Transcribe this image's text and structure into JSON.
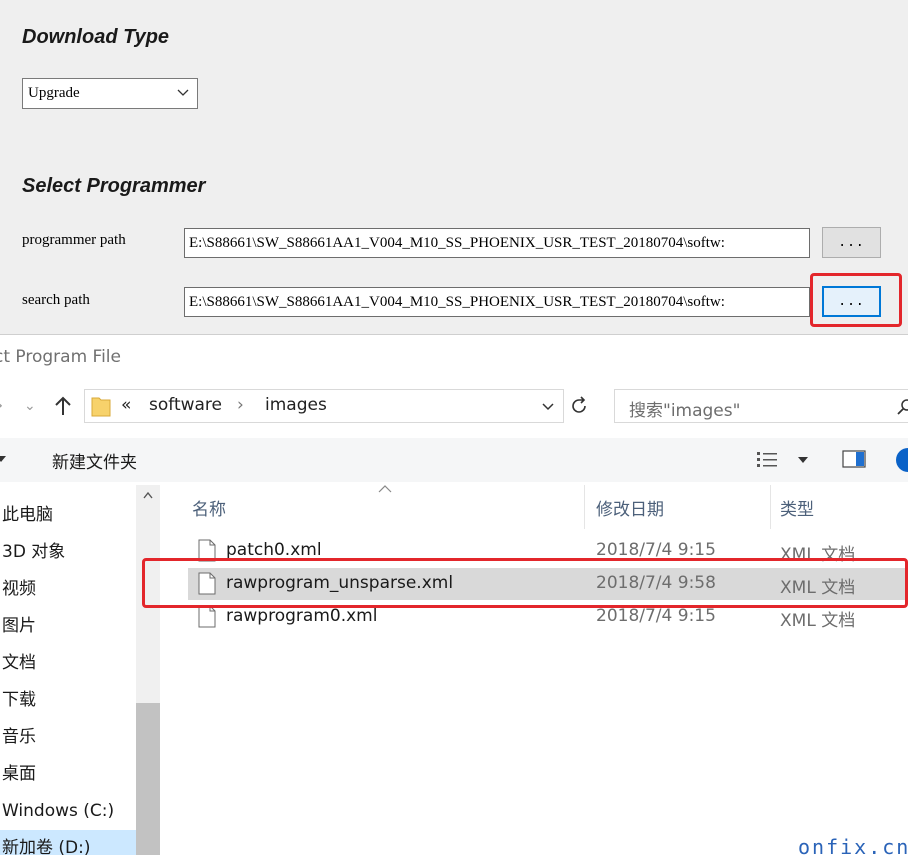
{
  "tool": {
    "download_type_heading": "Download Type",
    "download_type_value": "Upgrade",
    "select_programmer_heading": "Select Programmer",
    "programmer_path_label": "programmer path",
    "programmer_path_value": "E:\\S88661\\SW_S88661AA1_V004_M10_SS_PHOENIX_USR_TEST_20180704\\softw:",
    "search_path_label": "search path",
    "search_path_value": "E:\\S88661\\SW_S88661AA1_V004_M10_SS_PHOENIX_USR_TEST_20180704\\softw:",
    "browse_label": "..."
  },
  "dialog": {
    "title": "ct Program File",
    "breadcrumb": {
      "overflow": "«",
      "parent": "software",
      "sep": "›",
      "current": "images"
    },
    "search_placeholder": "搜索\"images\"",
    "new_folder": "新建文件夹",
    "nav_items": [
      {
        "label": "此电脑",
        "selected": false
      },
      {
        "label": "3D 对象",
        "selected": false
      },
      {
        "label": "视频",
        "selected": false
      },
      {
        "label": "图片",
        "selected": false
      },
      {
        "label": "文档",
        "selected": false
      },
      {
        "label": "下载",
        "selected": false
      },
      {
        "label": "音乐",
        "selected": false
      },
      {
        "label": "桌面",
        "selected": false
      },
      {
        "label": "Windows (C:)",
        "selected": false
      },
      {
        "label": "新加卷 (D:)",
        "selected": true
      }
    ],
    "columns": {
      "name": "名称",
      "date": "修改日期",
      "type": "类型"
    },
    "files": [
      {
        "name": "patch0.xml",
        "date": "2018/7/4 9:15",
        "type": "XML 文档",
        "selected": false
      },
      {
        "name": "rawprogram_unsparse.xml",
        "date": "2018/7/4 9:58",
        "type": "XML 文档",
        "selected": true
      },
      {
        "name": "rawprogram0.xml",
        "date": "2018/7/4 9:15",
        "type": "XML 文档",
        "selected": false
      }
    ]
  },
  "watermark": "onfix.cn",
  "colors": {
    "highlight_box": "#e3262b",
    "selected_nav": "#cce8ff",
    "selected_row": "#d9d9d9"
  }
}
